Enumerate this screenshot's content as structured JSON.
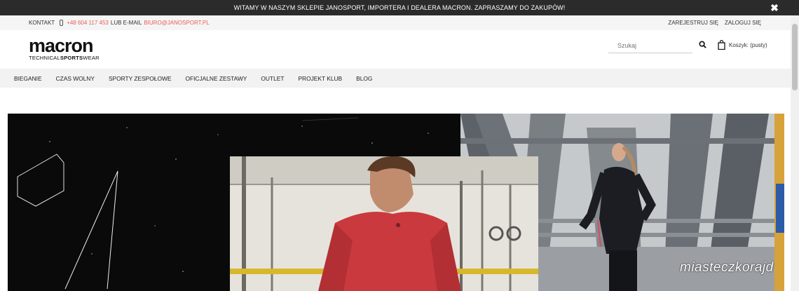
{
  "announcement": {
    "text": "Witamy w naszym sklepie Janosport, importera i dealera Macron. Zapraszamy do zakupów!",
    "close_icon": "close-icon"
  },
  "infobar": {
    "contact_label": "Kontakt",
    "phone": "+48 604 117 453",
    "or_label": "lub e-mail",
    "email": "biuro@janosport.pl",
    "register": "Zarejestruj się",
    "login": "Zaloguj się"
  },
  "logo": {
    "brand": "macron",
    "tag_pre": "TECHNICAL",
    "tag_bold": "SPORTS",
    "tag_post": "WEAR"
  },
  "search": {
    "placeholder": "Szukaj",
    "icon": "search-icon"
  },
  "cart": {
    "label": "Koszyk: (pusty)",
    "icon": "shopping-bag-icon"
  },
  "nav": {
    "items": [
      "Bieganie",
      "Czas wolny",
      "Sporty zespołowe",
      "Oficjalne zestawy",
      "Outlet",
      "Projekt Klub",
      "Blog"
    ]
  },
  "watermark": "miasteczkorajd",
  "colors": {
    "accent": "#e85c5c",
    "topbar": "#2b2b2b",
    "nav_bg": "#f2f2f2",
    "jersey_red": "#c9393d"
  }
}
